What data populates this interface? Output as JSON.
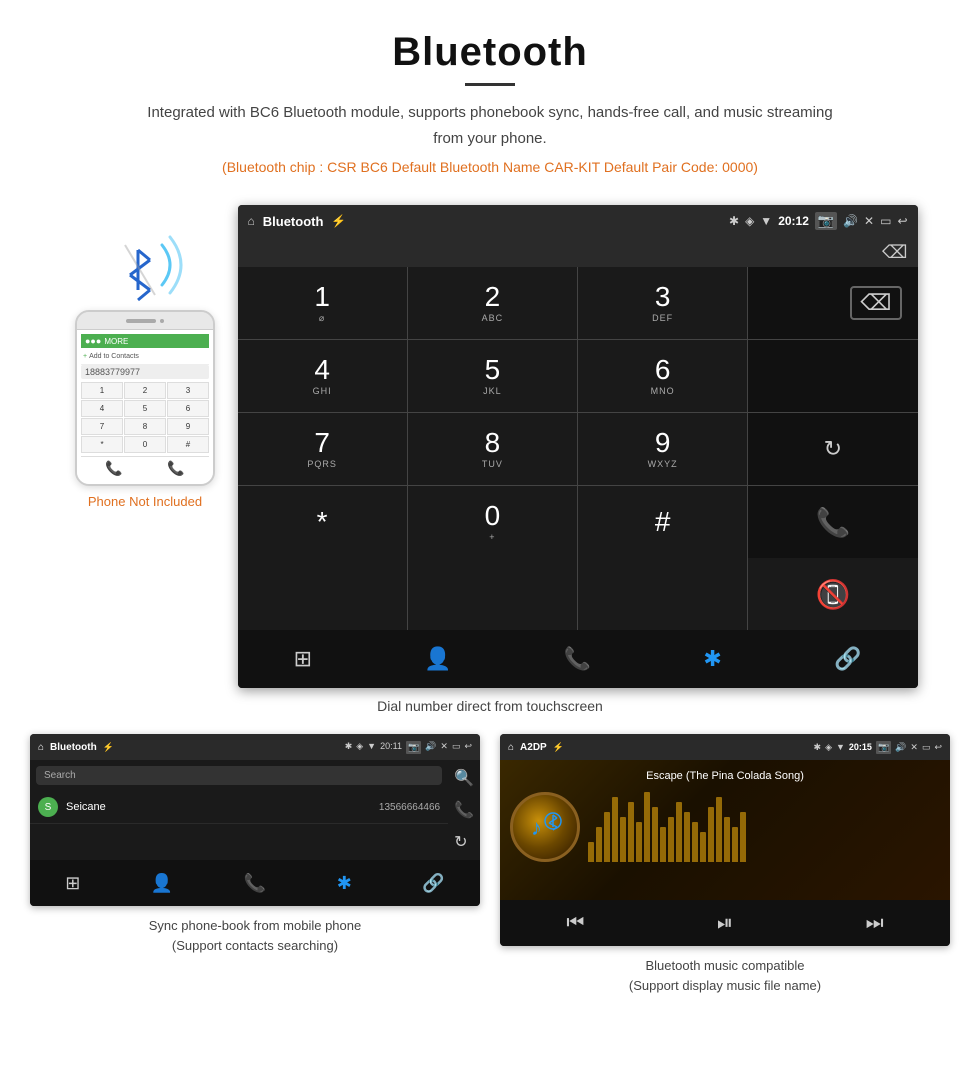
{
  "header": {
    "title": "Bluetooth",
    "description": "Integrated with BC6 Bluetooth module, supports phonebook sync, hands-free call, and music streaming from your phone.",
    "specs": "(Bluetooth chip : CSR BC6    Default Bluetooth Name CAR-KIT    Default Pair Code: 0000)"
  },
  "phone_aside": {
    "not_included": "Phone Not Included"
  },
  "android_dial": {
    "status_bar": {
      "home_icon": "⌂",
      "title": "Bluetooth",
      "usb_icon": "⚡",
      "bt_icon": "✱",
      "location_icon": "◈",
      "wifi_icon": "▼",
      "time": "20:12",
      "camera_icon": "📷",
      "volume_icon": "🔊",
      "close_icon": "✕",
      "window_icon": "▭",
      "back_icon": "↩"
    },
    "keys": [
      {
        "num": "1",
        "letters": ""
      },
      {
        "num": "2",
        "letters": "ABC"
      },
      {
        "num": "3",
        "letters": "DEF"
      },
      {
        "num": "",
        "letters": "",
        "action": "delete"
      },
      {
        "num": "4",
        "letters": "GHI"
      },
      {
        "num": "5",
        "letters": "JKL"
      },
      {
        "num": "6",
        "letters": "MNO"
      },
      {
        "num": "",
        "letters": "",
        "action": "empty"
      },
      {
        "num": "7",
        "letters": "PQRS"
      },
      {
        "num": "8",
        "letters": "TUV"
      },
      {
        "num": "9",
        "letters": "WXYZ"
      },
      {
        "num": "",
        "letters": "",
        "action": "reload"
      },
      {
        "num": "*",
        "letters": ""
      },
      {
        "num": "0",
        "letters": "+"
      },
      {
        "num": "#",
        "letters": ""
      },
      {
        "num": "",
        "letters": "",
        "action": "call"
      },
      {
        "num": "",
        "letters": "",
        "action": "end"
      }
    ],
    "bottom_nav": [
      "⊞",
      "👤",
      "📞",
      "✱",
      "🔗"
    ],
    "caption": "Dial number direct from touchscreen"
  },
  "phonebook_screen": {
    "status_bar_title": "Bluetooth",
    "time": "20:11",
    "search_placeholder": "Search",
    "contact": {
      "letter": "S",
      "name": "Seicane",
      "number": "13566664466"
    },
    "caption": "Sync phone-book from mobile phone\n(Support contacts searching)"
  },
  "music_screen": {
    "status_bar_title": "A2DP",
    "time": "20:15",
    "song_title": "Escape (The Pina Colada Song)",
    "eq_bars": [
      20,
      35,
      50,
      65,
      45,
      60,
      40,
      70,
      55,
      35,
      45,
      60,
      50,
      40,
      30,
      55,
      65,
      45,
      35,
      50
    ],
    "caption": "Bluetooth music compatible\n(Support display music file name)"
  }
}
